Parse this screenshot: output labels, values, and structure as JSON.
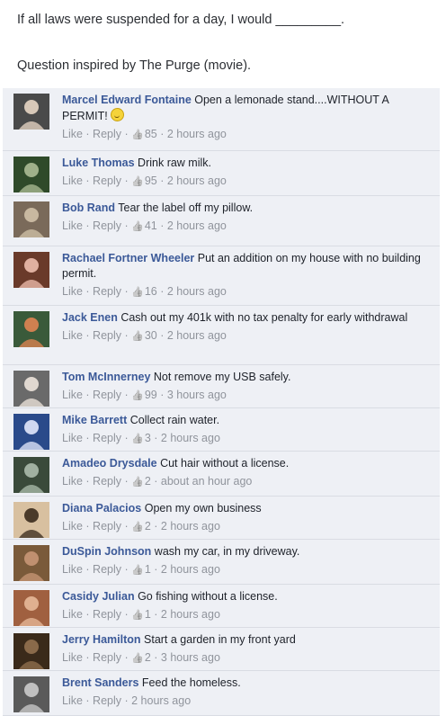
{
  "post": {
    "line1": "If all laws were suspended for a day, I would _________.",
    "line2": "Question inspired by The Purge (movie)."
  },
  "actions": {
    "like": "Like",
    "reply": "Reply",
    "sep": " · "
  },
  "comments": [
    {
      "name": "Marcel Edward Fontaine",
      "text": "Open a lemonade stand....WITHOUT A PERMIT!",
      "likes": "85",
      "time": "2 hours ago",
      "emoji": "smile-emoji"
    },
    {
      "name": "Luke Thomas",
      "text": "Drink raw milk.",
      "likes": "95",
      "time": "2 hours ago"
    },
    {
      "name": "Bob Rand",
      "text": "Tear the label off my pillow.",
      "likes": "41",
      "time": "2 hours ago"
    },
    {
      "name": "Rachael Fortner Wheeler",
      "text": "Put an addition on my house with no building permit.",
      "likes": "16",
      "time": "2 hours ago"
    },
    {
      "name": "Jack Enen",
      "text": "Cash out my 401k with no tax penalty for early withdrawal",
      "likes": "30",
      "time": "2 hours ago"
    },
    {
      "name": "Tom McInnerney",
      "text": "Not remove my USB safely.",
      "likes": "99",
      "time": "3 hours ago"
    },
    {
      "name": "Mike Barrett",
      "text": "Collect rain water.",
      "likes": "3",
      "time": "2 hours ago"
    },
    {
      "name": "Amadeo Drysdale",
      "text": "Cut hair without a license.",
      "likes": "2",
      "time": "about an hour ago"
    },
    {
      "name": "Diana Palacios",
      "text": "Open my own business",
      "likes": "2",
      "time": "2 hours ago"
    },
    {
      "name": "DuSpin Johnson",
      "text": "wash my car, in my driveway.",
      "likes": "1",
      "time": "2 hours ago"
    },
    {
      "name": "Casidy Julian",
      "text": "Go fishing without a license.",
      "likes": "1",
      "time": "2 hours ago"
    },
    {
      "name": "Jerry Hamilton",
      "text": "Start a garden in my front yard",
      "likes": "2",
      "time": "3 hours ago"
    },
    {
      "name": "Brent Sanders",
      "text": "Feed the homeless.",
      "likes": "",
      "time": "2 hours ago"
    }
  ],
  "colors": {
    "name": "#3b5998",
    "meta": "#90949c",
    "comment_bg": "#eef0f5"
  }
}
